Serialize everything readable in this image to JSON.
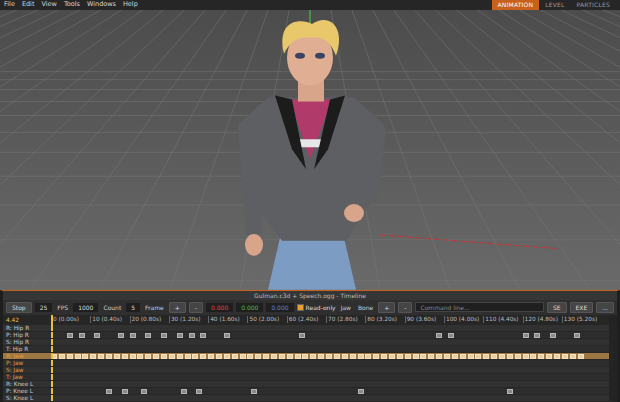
{
  "menu": [
    "File",
    "Edit",
    "View",
    "Tools",
    "Windows",
    "Help"
  ],
  "modes": [
    {
      "label": "ANIMATION",
      "selected": true
    },
    {
      "label": "LEVEL",
      "selected": false
    },
    {
      "label": "PARTICLES",
      "selected": false
    }
  ],
  "timeline": {
    "title": "Gulman.c3d + Speech.ogg - Timeline",
    "toolbar": [
      {
        "kind": "button",
        "text": "Stop"
      },
      {
        "kind": "value",
        "text": "25"
      },
      {
        "kind": "label",
        "text": "FPS"
      },
      {
        "kind": "value",
        "text": "1000"
      },
      {
        "kind": "label",
        "text": "Count"
      },
      {
        "kind": "value",
        "text": "5"
      },
      {
        "kind": "label",
        "text": "Frame"
      },
      {
        "kind": "button",
        "text": "+"
      },
      {
        "kind": "button",
        "text": "-"
      },
      {
        "kind": "coord",
        "text": "0.000",
        "color": "#e04848"
      },
      {
        "kind": "coord",
        "text": "0.000",
        "color": "#4cc04c"
      },
      {
        "kind": "coord",
        "text": "0.000",
        "color": "#6080e8"
      },
      {
        "kind": "check",
        "text": "Read-only",
        "checked": true
      },
      {
        "kind": "label",
        "text": "Jaw"
      },
      {
        "kind": "label",
        "text": "Bone"
      },
      {
        "kind": "button",
        "text": "+"
      },
      {
        "kind": "button",
        "text": "-"
      },
      {
        "kind": "input",
        "text": "Command line..."
      },
      {
        "kind": "button",
        "text": "SE"
      },
      {
        "kind": "button",
        "text": "EXE"
      },
      {
        "kind": "button",
        "text": "..."
      }
    ],
    "current": "4.42",
    "playhead_frame": 0,
    "ruler": [
      {
        "frame": 0,
        "text": "0 (0.00s)"
      },
      {
        "frame": 10,
        "text": "10 (0.40s)"
      },
      {
        "frame": 20,
        "text": "20 (0.80s)"
      },
      {
        "frame": 30,
        "text": "30 (1.20s)"
      },
      {
        "frame": 40,
        "text": "40 (1.60s)"
      },
      {
        "frame": 50,
        "text": "50 (2.00s)"
      },
      {
        "frame": 60,
        "text": "60 (2.40s)"
      },
      {
        "frame": 70,
        "text": "70 (2.80s)"
      },
      {
        "frame": 80,
        "text": "80 (3.20s)"
      },
      {
        "frame": 90,
        "text": "90 (3.60s)"
      },
      {
        "frame": 100,
        "text": "100 (4.00s)"
      },
      {
        "frame": 110,
        "text": "110 (4.40s)"
      },
      {
        "frame": 120,
        "text": "120 (4.80s)"
      },
      {
        "frame": 130,
        "text": "130 (5.20s)"
      }
    ],
    "tracks": [
      {
        "label": "R: Hip R",
        "selected": false,
        "bone": false,
        "keys": []
      },
      {
        "label": "P: Hip R",
        "selected": false,
        "bone": false,
        "keys": [
          4,
          7,
          11,
          17,
          20,
          24,
          28,
          32,
          35,
          38,
          44,
          63,
          98,
          101,
          120,
          123,
          127,
          133
        ]
      },
      {
        "label": "S: Hip R",
        "selected": false,
        "bone": false,
        "keys": []
      },
      {
        "label": "T: Hip R",
        "selected": false,
        "bone": false,
        "keys": []
      },
      {
        "label": "R: Jaw",
        "selected": true,
        "bone": true,
        "keys": [
          0,
          2,
          4,
          6,
          8,
          10,
          12,
          14,
          16,
          18,
          20,
          22,
          24,
          26,
          28,
          30,
          32,
          34,
          36,
          38,
          40,
          42,
          44,
          46,
          48,
          50,
          52,
          54,
          56,
          58,
          60,
          62,
          64,
          66,
          68,
          70,
          72,
          74,
          76,
          78,
          80,
          82,
          84,
          86,
          88,
          90,
          92,
          94,
          96,
          98,
          100,
          102,
          104,
          106,
          108,
          110,
          112,
          114,
          116,
          118,
          120,
          122,
          124,
          126,
          128,
          130,
          132,
          134
        ]
      },
      {
        "label": "P: Jaw",
        "selected": false,
        "bone": true,
        "keys": []
      },
      {
        "label": "S: Jaw",
        "selected": false,
        "bone": true,
        "keys": []
      },
      {
        "label": "T: Jaw",
        "selected": false,
        "bone": true,
        "keys": []
      },
      {
        "label": "R: Knee L",
        "selected": false,
        "bone": false,
        "keys": []
      },
      {
        "label": "P: Knee L",
        "selected": false,
        "bone": false,
        "keys": [
          14,
          18,
          23,
          33,
          37,
          51,
          78,
          116
        ]
      },
      {
        "label": "S: Knee L",
        "selected": false,
        "bone": false,
        "keys": []
      }
    ]
  }
}
